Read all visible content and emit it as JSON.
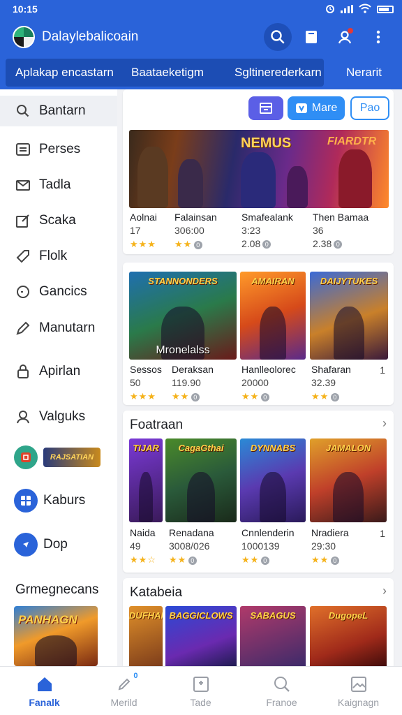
{
  "status_bar": {
    "time": "10:15"
  },
  "app_bar": {
    "title": "Dalaylebalicoain",
    "icons": [
      "search-icon",
      "book-icon",
      "account-icon",
      "more-icon"
    ],
    "accent": "#2a63d9"
  },
  "tabs": [
    {
      "label": "Aplakap encastarn"
    },
    {
      "label": "Baataeketigm"
    },
    {
      "label": "Sgltinerederkarn"
    },
    {
      "label": "Nerarit"
    }
  ],
  "sidebar": {
    "items": [
      {
        "label": "Bantarn",
        "icon": "search-icon"
      },
      {
        "label": "Perses",
        "icon": "list-icon"
      },
      {
        "label": "Tadla",
        "icon": "mail-icon"
      },
      {
        "label": "Scaka",
        "icon": "edit-icon"
      },
      {
        "label": "Flolk",
        "icon": "tag-icon"
      },
      {
        "label": "Gancics",
        "icon": "clock-icon"
      },
      {
        "label": "Manutarn",
        "icon": "brush-icon"
      },
      {
        "label": "Apirlan",
        "icon": "lock-icon"
      },
      {
        "label": "Valguks",
        "icon": "person-icon"
      },
      {
        "label": "Kaburs",
        "icon": "grid-icon"
      },
      {
        "label": "Dop",
        "icon": "compass-icon"
      }
    ],
    "promo_label": "RAJSATIAN",
    "section_title": "Grmegnecans",
    "thumb_title": "PANHAGN"
  },
  "toolbar": {
    "more_label": "Mare",
    "pao_label": "Pao"
  },
  "hero": {
    "title": "NEMUS",
    "subtitle": "FIARDTR"
  },
  "row1": [
    {
      "name": "Aolnai",
      "sub": "17",
      "extra": ""
    },
    {
      "name": "Falainsan",
      "sub": "306:00",
      "extra": ""
    },
    {
      "name": "Smafealank",
      "sub": "3:23",
      "extra": "2.08"
    },
    {
      "name": "Then Bamaa",
      "sub": "36",
      "extra": "2.38"
    }
  ],
  "row2": {
    "thumbs": [
      {
        "title": "STANNONDERS",
        "caption": "Mronelalss"
      },
      {
        "title": "AMAIRAN",
        "caption": ""
      },
      {
        "title": "DAIJYTUKES",
        "caption": ""
      }
    ],
    "items": [
      {
        "name": "Sessos",
        "sub": "50"
      },
      {
        "name": "Deraksan",
        "sub": "119.90"
      },
      {
        "name": "Hanlleolorec",
        "sub": "20000"
      },
      {
        "name": "Shafaran",
        "sub": "32.39"
      }
    ],
    "count": "1"
  },
  "section2": {
    "title": "Foatraan",
    "thumbs": [
      {
        "title": "TIJAR"
      },
      {
        "title": "CagaGthai"
      },
      {
        "title": "DYNNABS"
      },
      {
        "title": "JAMALON"
      }
    ],
    "items": [
      {
        "name": "Naida",
        "sub": "49"
      },
      {
        "name": "Renadana",
        "sub": "3008/026"
      },
      {
        "name": "Cnnlenderin",
        "sub": "1000139"
      },
      {
        "name": "Nradiera",
        "sub": "29:30"
      }
    ],
    "count": "1"
  },
  "section3": {
    "title": "Katabeia",
    "thumbs": [
      {
        "title": "DUFHANS"
      },
      {
        "title": "BAGGICLOWS"
      },
      {
        "title": "SABAGUS"
      },
      {
        "title": "DugopeL"
      }
    ]
  },
  "bottom_nav": [
    {
      "label": "Fanalk",
      "icon": "home-icon",
      "active": true
    },
    {
      "label": "Merild",
      "icon": "rocket-icon",
      "badge": "0"
    },
    {
      "label": "Tade",
      "icon": "calendar-icon"
    },
    {
      "label": "Franoe",
      "icon": "search-icon"
    },
    {
      "label": "Kaignagn",
      "icon": "image-icon"
    }
  ]
}
